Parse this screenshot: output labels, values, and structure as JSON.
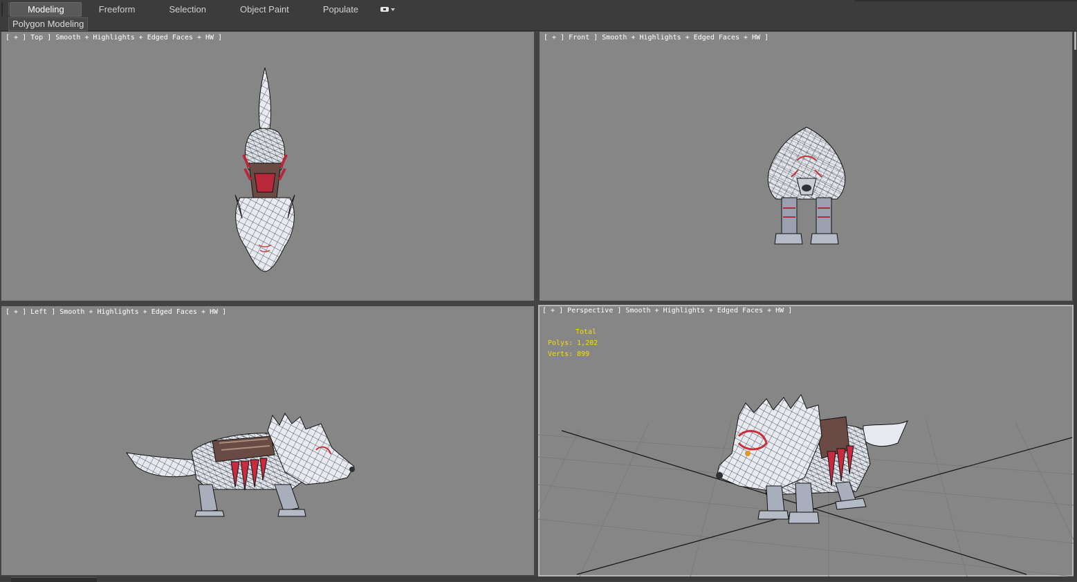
{
  "ribbon": {
    "tabs": [
      {
        "label": "Modeling",
        "active": true
      },
      {
        "label": "Freeform",
        "active": false
      },
      {
        "label": "Selection",
        "active": false
      },
      {
        "label": "Object Paint",
        "active": false
      },
      {
        "label": "Populate",
        "active": false
      }
    ],
    "options_icon": "toggle-dropdown-icon"
  },
  "subbar": {
    "panel_label": "Polygon Modeling"
  },
  "viewports": {
    "top": {
      "label": "[ + ] Top ] Smooth + Highlights + Edged Faces + HW ]"
    },
    "front": {
      "label": "[ + ] Front ] Smooth + Highlights + Edged Faces + HW ]"
    },
    "left": {
      "label": "[ + ] Left ] Smooth + Highlights + Edged Faces + HW ]"
    },
    "perspective": {
      "label": "[ + ] Perspective ] Smooth + Highlights + Edged Faces + HW ]",
      "stats": {
        "title": "Total",
        "polys": "Polys: 1,202",
        "verts": "Verts: 899"
      }
    }
  },
  "colors": {
    "viewport_bg": "#868686",
    "ui_bg": "#3c3c3c",
    "stats_text": "#f0e000",
    "model_fur": "#e8ecf2",
    "model_red": "#b8283a",
    "model_saddle": "#6a4a44"
  }
}
